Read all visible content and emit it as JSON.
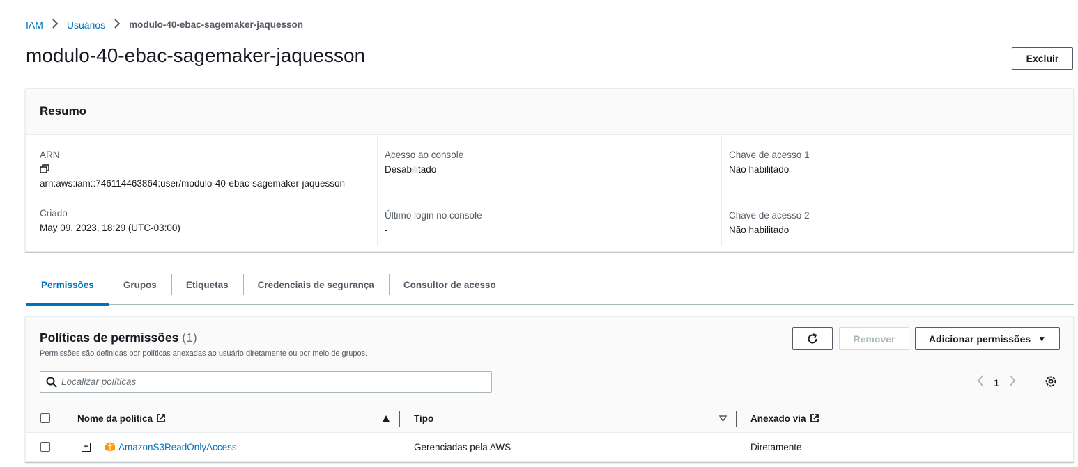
{
  "breadcrumb": {
    "items": [
      "IAM",
      "Usuários"
    ],
    "current": "modulo-40-ebac-sagemaker-jaquesson"
  },
  "page": {
    "title": "modulo-40-ebac-sagemaker-jaquesson",
    "delete_label": "Excluir"
  },
  "summary": {
    "header": "Resumo",
    "arn_label": "ARN",
    "arn_value": "arn:aws:iam::746114463864:user/modulo-40-ebac-sagemaker-jaquesson",
    "created_label": "Criado",
    "created_value": "May 09, 2023, 18:29 (UTC-03:00)",
    "console_access_label": "Acesso ao console",
    "console_access_value": "Desabilitado",
    "last_login_label": "Último login no console",
    "last_login_value": "-",
    "key1_label": "Chave de acesso 1",
    "key1_value": "Não habilitado",
    "key2_label": "Chave de acesso 2",
    "key2_value": "Não habilitado"
  },
  "tabs": [
    "Permissões",
    "Grupos",
    "Etiquetas",
    "Credenciais de segurança",
    "Consultor de acesso"
  ],
  "policies": {
    "title": "Políticas de permissões",
    "count": "(1)",
    "description": "Permissões são definidas por políticas anexadas ao usuário diretamente ou por meio de grupos.",
    "remove_label": "Remover",
    "add_label": "Adicionar permissões",
    "search_placeholder": "Localizar políticas",
    "page_number": "1",
    "columns": {
      "name": "Nome da política",
      "type": "Tipo",
      "attached": "Anexado via"
    },
    "rows": [
      {
        "name": "AmazonS3ReadOnlyAccess",
        "type": "Gerenciadas pela AWS",
        "attached": "Diretamente"
      }
    ]
  },
  "colors": {
    "link": "#0073bb",
    "policy_icon": "#ff9900"
  }
}
